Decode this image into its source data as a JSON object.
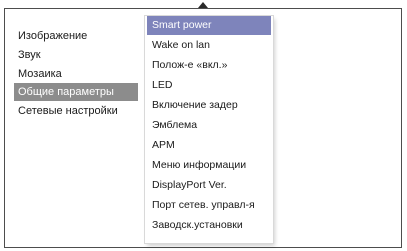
{
  "left_menu": {
    "items": [
      {
        "label": "Изображение"
      },
      {
        "label": "Звук"
      },
      {
        "label": "Мозаика"
      },
      {
        "label": "Общие параметры",
        "selected": true
      },
      {
        "label": "Сетевые настройки"
      }
    ]
  },
  "submenu": {
    "items": [
      {
        "label": "Smart power",
        "active": true
      },
      {
        "label": "Wake on lan"
      },
      {
        "label": "Полож-е «вкл.»"
      },
      {
        "label": "LED"
      },
      {
        "label": "Включение задер"
      },
      {
        "label": "Эмблема"
      },
      {
        "label": "APM"
      },
      {
        "label": "Меню информации"
      },
      {
        "label": " DisplayPort Ver."
      },
      {
        "label": " Порт сетев. управл-я"
      },
      {
        "label": "Заводск.установки"
      }
    ]
  },
  "colors": {
    "selected_bg": "#8c8c8c",
    "active_bg": "#7e84bb",
    "frame": "#4d4d4d"
  },
  "icons": {
    "scroll_up": "triangle-up-icon"
  }
}
